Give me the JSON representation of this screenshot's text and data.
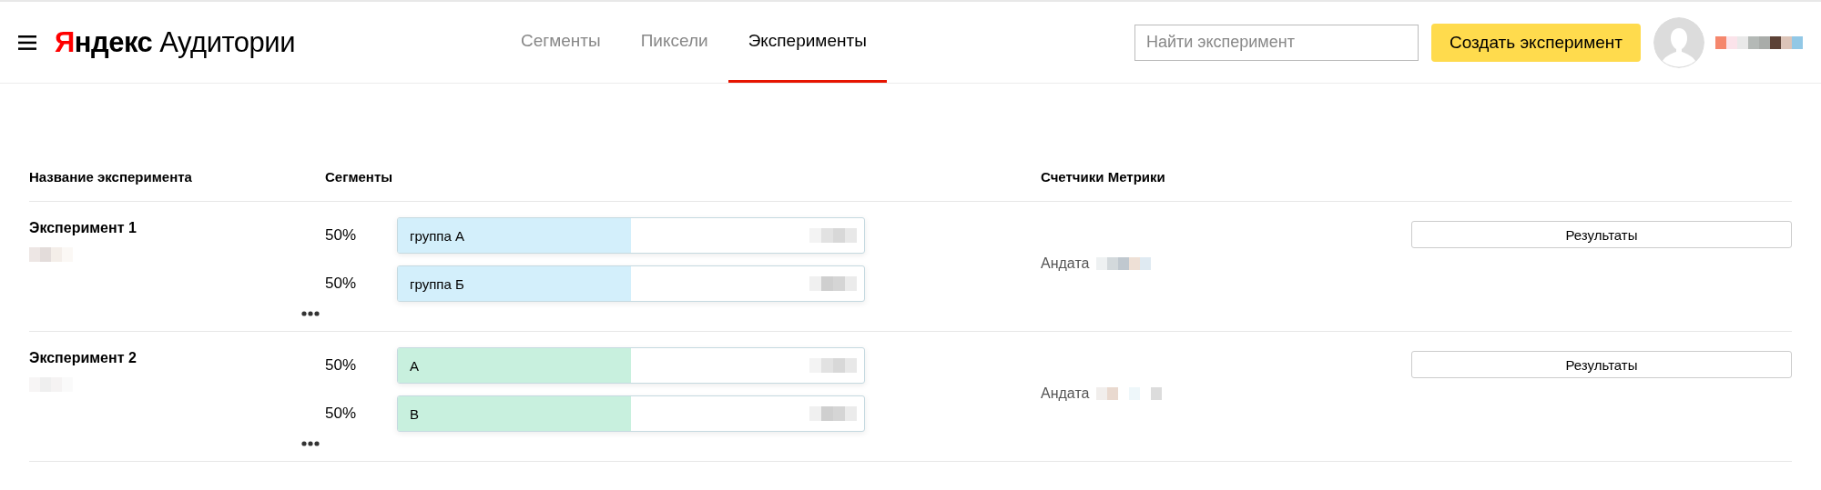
{
  "header": {
    "logo": {
      "brand": "Яндекс",
      "product": "Аудитории"
    },
    "tabs": [
      {
        "label": "Сегменты",
        "selected": false
      },
      {
        "label": "Пиксели",
        "selected": false
      },
      {
        "label": "Эксперименты",
        "selected": true
      }
    ],
    "search": {
      "placeholder": "Найти эксперимент"
    },
    "create_button": "Создать эксперимент"
  },
  "table": {
    "columns": [
      "Название эксперимента",
      "Сегменты",
      "Счетчики Метрики"
    ],
    "rows": [
      {
        "name": "Эксперимент 1",
        "segments": [
          {
            "share": "50%",
            "label": "группа А",
            "level": 0.5,
            "color": "#d3effb"
          },
          {
            "share": "50%",
            "label": "группа Б",
            "level": 0.5,
            "color": "#d3effb"
          }
        ],
        "counter": "Андата",
        "results_button": "Результаты"
      },
      {
        "name": "Эксперимент 2",
        "segments": [
          {
            "share": "50%",
            "label": "А",
            "level": 0.5,
            "color": "#c8f0de"
          },
          {
            "share": "50%",
            "label": "В",
            "level": 0.5,
            "color": "#c8f0de"
          }
        ],
        "counter": "Андата",
        "results_button": "Результаты"
      }
    ]
  }
}
